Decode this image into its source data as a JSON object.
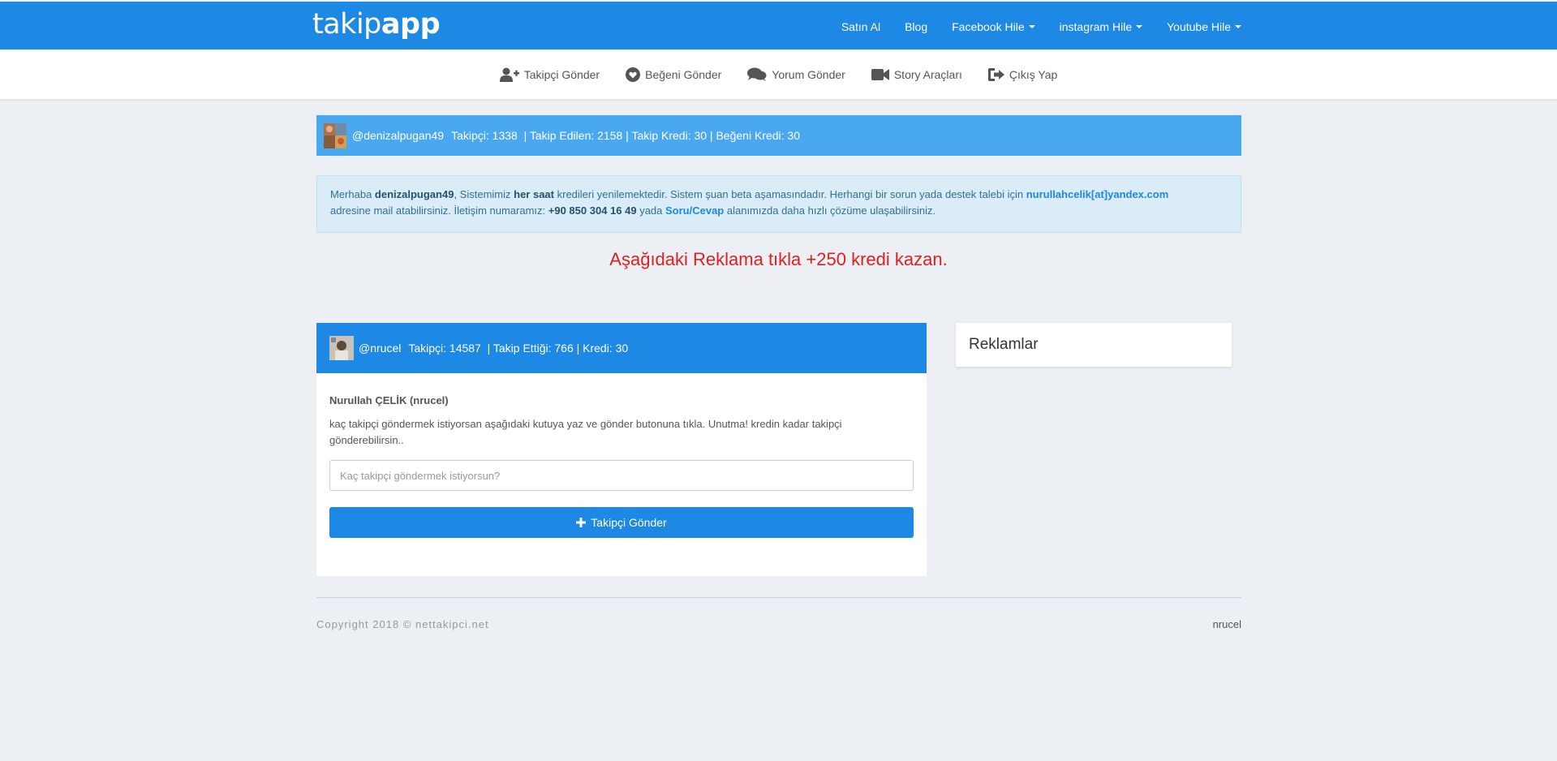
{
  "brand": {
    "part1": "takip",
    "part2": "app"
  },
  "topnav": [
    {
      "label": "Satın Al",
      "dropdown": false
    },
    {
      "label": "Blog",
      "dropdown": false
    },
    {
      "label": "Facebook Hile",
      "dropdown": true
    },
    {
      "label": "instagram Hile",
      "dropdown": true
    },
    {
      "label": "Youtube Hile",
      "dropdown": true
    }
  ],
  "subnav": [
    {
      "label": "Takipçi Gönder",
      "icon": "user-plus-icon"
    },
    {
      "label": "Beğeni Gönder",
      "icon": "heart-icon"
    },
    {
      "label": "Yorum Gönder",
      "icon": "comments-icon"
    },
    {
      "label": "Story Araçları",
      "icon": "video-camera-icon"
    },
    {
      "label": "Çıkış Yap",
      "icon": "sign-out-icon"
    }
  ],
  "userbar": {
    "username": "@denizalpugan49",
    "stats": "Takipçi: 1338  | Takip Edilen: 2158 | Takip Kredi: 30 | Beğeni Kredi: 30"
  },
  "alert": {
    "greeting": "Merhaba ",
    "name": "denizalpugan49",
    "t1": ", Sistemimiz ",
    "bold1": "her saat",
    "t2": " kredileri yenilemektedir. Sistem şuan beta aşamasındadır. Herhangi bir sorun yada destek talebi için ",
    "email": "nurullahcelik[at]yandex.com",
    "t3": "adresine mail atabilirsiniz. İletişim numaramız: ",
    "phone": "+90 850 304 16 49",
    "t4": " yada ",
    "link": "Soru/Cevap",
    "t5": " alanımızda daha hızlı çözüme ulaşabilirsiniz."
  },
  "promo": "Aşağıdaki Reklama tıkla +250 kredi kazan.",
  "panel": {
    "username": "@nrucel",
    "stats": "Takipçi: 14587  | Takip Ettiği: 766 | Kredi: 30",
    "title": "Nurullah ÇELİK (nrucel)",
    "description": "kaç takipçi göndermek istiyorsan aşağıdaki kutuya yaz ve gönder butonuna tıkla. Unutma! kredin kadar takipçi gönderebilirsin..",
    "input_placeholder": "Kaç takipçi göndermek istiyorsun?",
    "button_label": "Takipçi Gönder"
  },
  "ads": {
    "title": "Reklamlar"
  },
  "footer": {
    "copyright": "Copyright 2018 © nettakipci.net",
    "user": "nrucel"
  },
  "colors": {
    "primary": "#1e88e5",
    "userbar": "#4aa8f0",
    "promo": "#e02020",
    "background": "#eceff3"
  }
}
